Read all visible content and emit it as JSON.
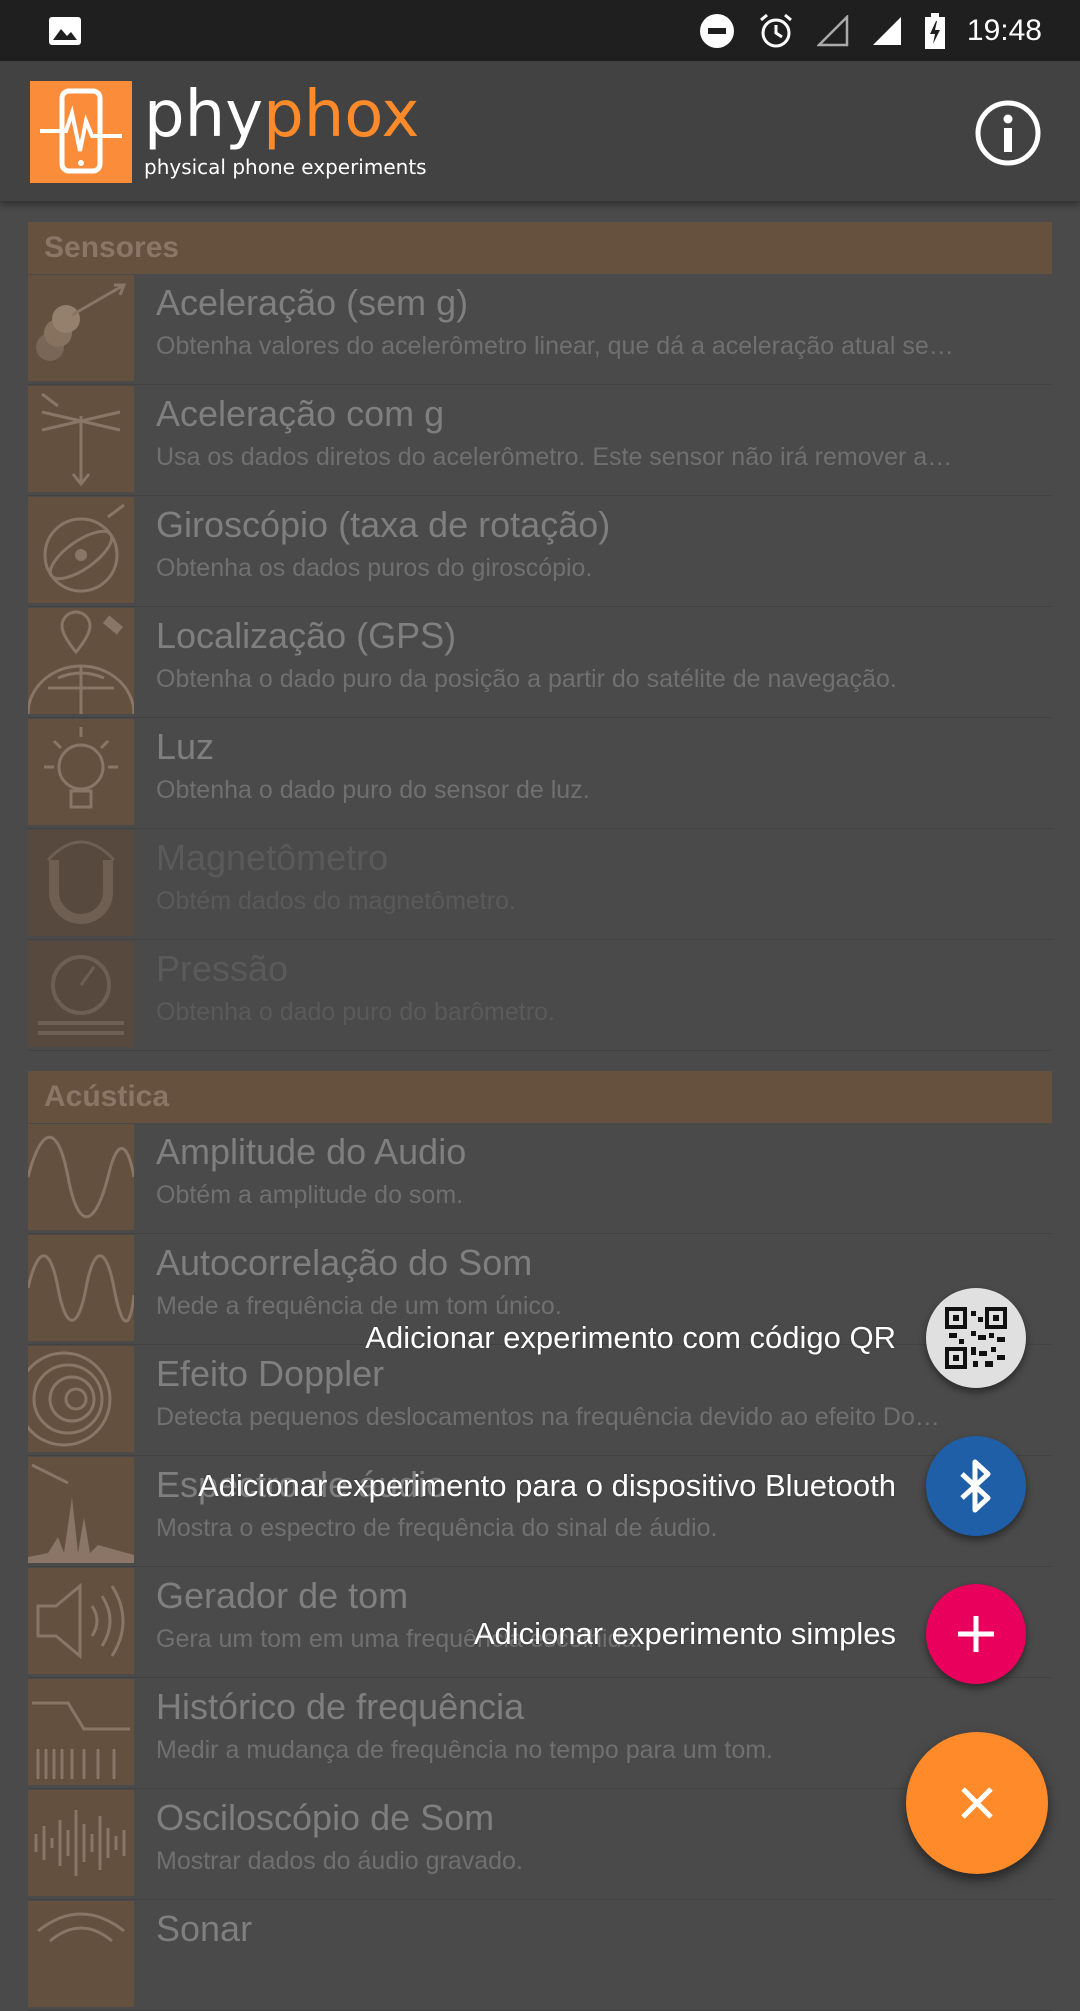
{
  "status_bar": {
    "time": "19:48",
    "icons": [
      "image-icon",
      "dnd-icon",
      "alarm-icon",
      "signal-empty-icon",
      "signal-full-icon",
      "battery-charging-icon"
    ]
  },
  "app_bar": {
    "brand_part1": "phy",
    "brand_part2": "phox",
    "tagline": "physical phone experiments",
    "info_icon": "info-icon"
  },
  "colors": {
    "accent": "#ff8a2a",
    "qr_fab": "#e0e0e0",
    "bluetooth_fab": "#1f5fa8",
    "simple_fab": "#e8005c",
    "category_bg": "#66503e"
  },
  "categories": [
    {
      "title": "Sensores",
      "items": [
        {
          "title": "Aceleração (sem g)",
          "desc": "Obtenha valores do acelerômetro linear, que dá a aceleração atual se…",
          "icon": "acceleration-icon"
        },
        {
          "title": "Aceleração com g",
          "desc": "Usa os dados diretos do acelerômetro. Este sensor não irá remover a…",
          "icon": "acceleration-g-icon"
        },
        {
          "title": "Giroscópio (taxa de rotação)",
          "desc": "Obtenha os dados puros do giroscópio.",
          "icon": "gyroscope-icon"
        },
        {
          "title": "Localização (GPS)",
          "desc": "Obtenha o dado puro da posição a partir do satélite de navegação.",
          "icon": "gps-icon"
        },
        {
          "title": "Luz",
          "desc": "Obtenha o dado puro do sensor de luz.",
          "icon": "light-bulb-icon"
        },
        {
          "title": "Magnetômetro",
          "desc": "Obtém dados do magnetômetro.",
          "icon": "magnet-icon",
          "disabled": true
        },
        {
          "title": "Pressão",
          "desc": "Obtenha o dado puro do barômetro.",
          "icon": "barometer-icon",
          "disabled": true
        }
      ]
    },
    {
      "title": "Acústica",
      "items": [
        {
          "title": "Amplitude do Audio",
          "desc": "Obtém a amplitude do som.",
          "icon": "sine-wave-icon"
        },
        {
          "title": "Autocorrelação do Som",
          "desc": "Mede a frequência de um tom único.",
          "icon": "autocorrelation-icon"
        },
        {
          "title": "Efeito Doppler",
          "desc": "Detecta pequenos deslocamentos na frequência devido ao efeito Do…",
          "icon": "doppler-icon"
        },
        {
          "title": "Espectro de áudio",
          "desc": "Mostra o espectro de frequência do sinal de áudio.",
          "icon": "spectrum-icon"
        },
        {
          "title": "Gerador de tom",
          "desc": "Gera um tom em uma frequência escolhida.",
          "icon": "speaker-icon"
        },
        {
          "title": "Histórico de frequência",
          "desc": "Medir a mudança de frequência no tempo para um tom.",
          "icon": "frequency-history-icon"
        },
        {
          "title": "Osciloscópio de Som",
          "desc": "Mostrar dados do áudio gravado.",
          "icon": "oscilloscope-icon"
        },
        {
          "title": "Sonar",
          "desc": "",
          "icon": "sonar-icon"
        }
      ]
    }
  ],
  "fab_menu": {
    "qr_label": "Adicionar experimento com código QR",
    "bluetooth_label": "Adicionar experimento para o dispositivo Bluetooth",
    "simple_label": "Adicionar experimento simples",
    "close_icon": "close-icon"
  }
}
